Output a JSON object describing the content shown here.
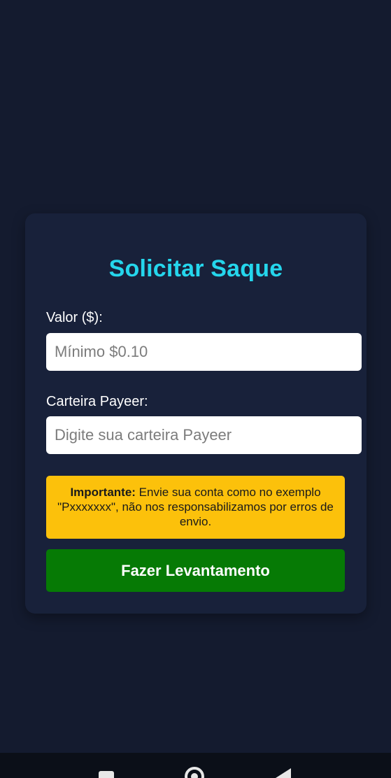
{
  "form": {
    "title": "Solicitar Saque",
    "amount_label": "Valor ($):",
    "amount_value": "",
    "amount_placeholder": "Mínimo $0.10",
    "wallet_label": "Carteira Payeer:",
    "wallet_value": "",
    "wallet_placeholder": "Digite sua carteira Payeer",
    "notice_strong": "Importante:",
    "notice_text": " Envie sua conta como no exemplo \"Pxxxxxxx\", não nos responsabilizamos por erros de envio.",
    "submit_label": "Fazer Levantamento"
  },
  "colors": {
    "background": "#141b2f",
    "card": "#18213a",
    "title": "#25d6ec",
    "notice": "#fcc10b",
    "submit": "#067a05"
  },
  "navbar": {
    "icons": [
      "recent-apps-icon",
      "home-icon",
      "back-icon"
    ]
  }
}
